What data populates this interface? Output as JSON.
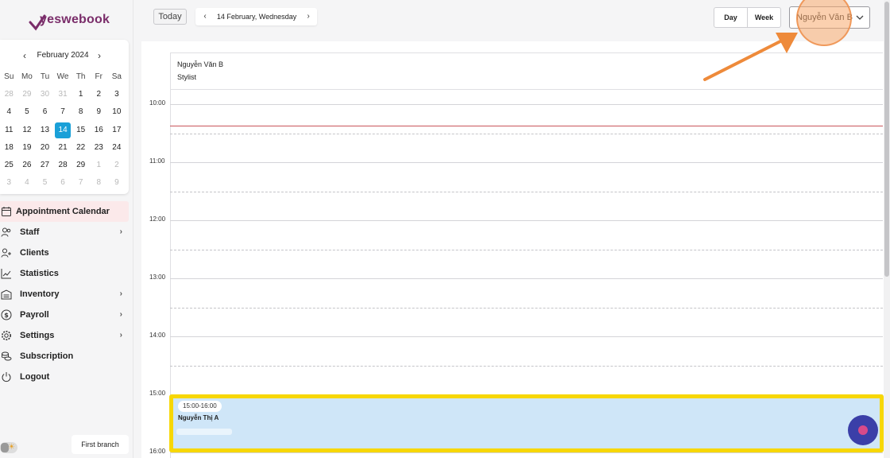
{
  "brand": {
    "logo_text": "yeswebook"
  },
  "mini_calendar": {
    "month_label": "February 2024",
    "weekdays": [
      "Su",
      "Mo",
      "Tu",
      "We",
      "Th",
      "Fr",
      "Sa"
    ],
    "weeks": [
      [
        {
          "d": "28",
          "out": true
        },
        {
          "d": "29",
          "out": true
        },
        {
          "d": "30",
          "out": true
        },
        {
          "d": "31",
          "out": true
        },
        {
          "d": "1"
        },
        {
          "d": "2"
        },
        {
          "d": "3"
        }
      ],
      [
        {
          "d": "4"
        },
        {
          "d": "5"
        },
        {
          "d": "6"
        },
        {
          "d": "7"
        },
        {
          "d": "8"
        },
        {
          "d": "9"
        },
        {
          "d": "10"
        }
      ],
      [
        {
          "d": "11"
        },
        {
          "d": "12"
        },
        {
          "d": "13"
        },
        {
          "d": "14",
          "today": true
        },
        {
          "d": "15"
        },
        {
          "d": "16"
        },
        {
          "d": "17"
        }
      ],
      [
        {
          "d": "18"
        },
        {
          "d": "19"
        },
        {
          "d": "20"
        },
        {
          "d": "21"
        },
        {
          "d": "22"
        },
        {
          "d": "23"
        },
        {
          "d": "24"
        }
      ],
      [
        {
          "d": "25"
        },
        {
          "d": "26"
        },
        {
          "d": "27"
        },
        {
          "d": "28"
        },
        {
          "d": "29"
        },
        {
          "d": "1",
          "out": true
        },
        {
          "d": "2",
          "out": true
        }
      ],
      [
        {
          "d": "3",
          "out": true
        },
        {
          "d": "4",
          "out": true
        },
        {
          "d": "5",
          "out": true
        },
        {
          "d": "6",
          "out": true
        },
        {
          "d": "7",
          "out": true
        },
        {
          "d": "8",
          "out": true
        },
        {
          "d": "9",
          "out": true
        }
      ]
    ]
  },
  "nav": {
    "items": [
      {
        "label": "Appointment Calendar",
        "icon": "calendar-icon",
        "active": true,
        "has_submenu": false
      },
      {
        "label": "Staff",
        "icon": "staff-icon",
        "active": false,
        "has_submenu": true
      },
      {
        "label": "Clients",
        "icon": "add-user-icon",
        "active": false,
        "has_submenu": false
      },
      {
        "label": "Statistics",
        "icon": "chart-icon",
        "active": false,
        "has_submenu": false
      },
      {
        "label": "Inventory",
        "icon": "warehouse-icon",
        "active": false,
        "has_submenu": true
      },
      {
        "label": "Payroll",
        "icon": "dollar-icon",
        "active": false,
        "has_submenu": true
      },
      {
        "label": "Settings",
        "icon": "gear-icon",
        "active": false,
        "has_submenu": true
      },
      {
        "label": "Subscription",
        "icon": "coins-icon",
        "active": false,
        "has_submenu": false
      },
      {
        "label": "Logout",
        "icon": "power-icon",
        "active": false,
        "has_submenu": false
      }
    ]
  },
  "footer": {
    "branch_label": "First branch"
  },
  "toolbar": {
    "today_label": "Today",
    "date_label": "14 February, Wednesday",
    "view_day": "Day",
    "view_week": "Week",
    "staff_selected": "Nguyễn Văn B"
  },
  "calendar": {
    "column": {
      "staff_name": "Nguyễn Văn B",
      "staff_role": "Stylist"
    },
    "hours": [
      "10:00",
      "11:00",
      "12:00",
      "13:00",
      "14:00",
      "15:00",
      "16:00"
    ],
    "event": {
      "time_range": "15:00-16:00",
      "client_name": "Nguyễn Thị A"
    }
  },
  "colors": {
    "accent_today": "#1aa0d8",
    "active_nav_bg": "#fbe9ea",
    "event_bg": "#cfe6f8",
    "event_highlight": "#f7d705",
    "annotation_arrow": "#ee8a3a",
    "now_line": "#c9555a"
  }
}
